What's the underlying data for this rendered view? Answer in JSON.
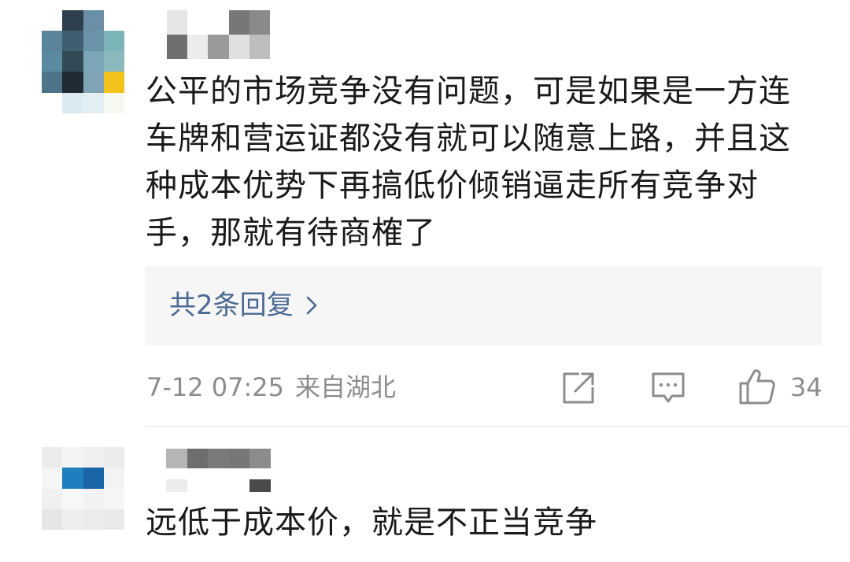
{
  "comments": [
    {
      "username": "",
      "text": "公平的市场竞争没有问题，可是如果是一方连车牌和营运证都没有就可以随意上路，并且这种成本优势下再搞低价倾销逼走所有竞争对手，那就有待商榷了",
      "replies_label": "共2条回复",
      "timestamp": "7-12 07:25",
      "location": "来自湖北",
      "like_count": "34",
      "icons": [
        "share-icon",
        "comment-icon",
        "like-icon",
        "chevron-right-icon"
      ]
    },
    {
      "username": "",
      "text": "远低于成本价，就是不正当竞争"
    }
  ],
  "colors": {
    "link": "#4b6a93",
    "meta": "#8c8c8c",
    "text": "#1a1a1a",
    "reply_bg": "#f6f6f6"
  }
}
